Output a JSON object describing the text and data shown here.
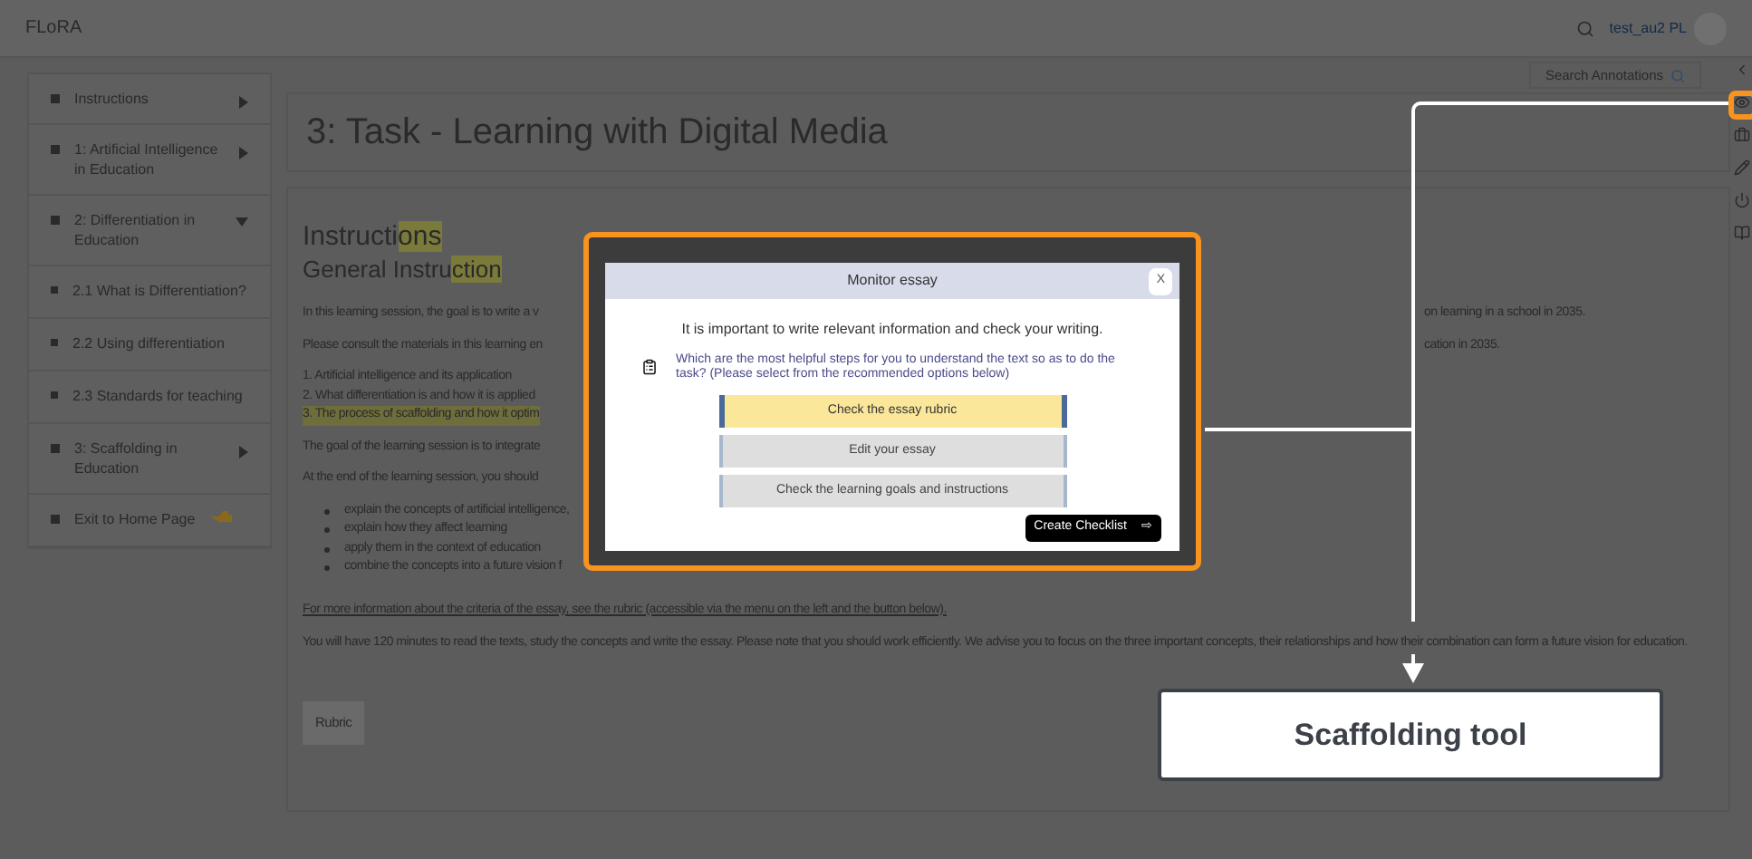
{
  "app": {
    "name": "FLoRA"
  },
  "user": {
    "name": "test_au2 PL"
  },
  "search_annotations": {
    "label": "Search Annotations"
  },
  "sidebar": {
    "items": [
      {
        "kind": "section",
        "label": "Instructions",
        "expanded": false
      },
      {
        "kind": "section",
        "label": "1: Artificial Intelligence in Education",
        "expanded": false
      },
      {
        "kind": "section",
        "label": "2: Differentiation in Education",
        "expanded": true,
        "children": [
          {
            "label": "2.1 What is Differentiation?"
          },
          {
            "label": "2.2 Using differentiation"
          },
          {
            "label": "2.3 Standards for teaching"
          }
        ]
      },
      {
        "kind": "section",
        "label": "3: Scaffolding in Education",
        "expanded": false
      },
      {
        "kind": "exit",
        "label": "Exit to Home Page"
      }
    ]
  },
  "page_title": "3: Task - Learning with Digital Media",
  "content": {
    "heading": [
      {
        "text": "Instructi",
        "highlighted": false
      },
      {
        "text": "ons",
        "highlighted": true
      }
    ],
    "subheading": [
      {
        "text": "General Instru",
        "highlighted": false
      },
      {
        "text": "ction",
        "highlighted": true
      }
    ],
    "blocks": [
      {
        "kind": "split",
        "left": "In this learning session, the goal is to write a v",
        "right": "on learning in a school in 2035."
      },
      {
        "kind": "split",
        "left": "Please consult the materials in this learning en",
        "right": "cation in 2035."
      },
      {
        "kind": "lines",
        "lines": [
          {
            "text": "1. Artificial intelligence and its application",
            "highlighted": false
          },
          {
            "text": "2. What differentiation is and how it is applied",
            "highlighted": false
          },
          {
            "text": "3. The process of scaffolding and how it optim",
            "highlighted": true
          }
        ]
      },
      {
        "kind": "split",
        "left": "The goal of the learning session is to integrate"
      },
      {
        "kind": "split",
        "left": "At the end of the learning session, you should"
      },
      {
        "kind": "bullets",
        "items": [
          "explain the concepts of artificial intelligence,",
          "explain how they affect learning",
          "apply them in the context of education",
          "combine the concepts into a future vision f"
        ]
      },
      {
        "kind": "link",
        "text": "For more information about the criteria of the essay, see the rubric (accessible via the menu on the left and the button below)."
      },
      {
        "kind": "text",
        "text": "You will have 120 minutes to read the texts, study the concepts and write the essay. Please note that you should work efficiently. We advise you to focus on the three important concepts, their relationships and how their combination can form a future vision for education."
      }
    ],
    "rubric_button": "Rubric"
  },
  "modal": {
    "title": "Monitor essay",
    "close": "X",
    "message": "It is important to write relevant information and check your writing.",
    "question": "Which are the most helpful steps for you to understand the text so as to do the task? (Please select from the recommended options below)",
    "options": [
      {
        "label": "Check the essay rubric",
        "selected": true
      },
      {
        "label": "Edit your essay",
        "selected": false
      },
      {
        "label": "Check the learning goals and instructions",
        "selected": false
      }
    ],
    "checklist_button": {
      "label": "Create Checklist",
      "arrow": "⇨"
    }
  },
  "annotation": {
    "label": "Scaffolding tool"
  }
}
